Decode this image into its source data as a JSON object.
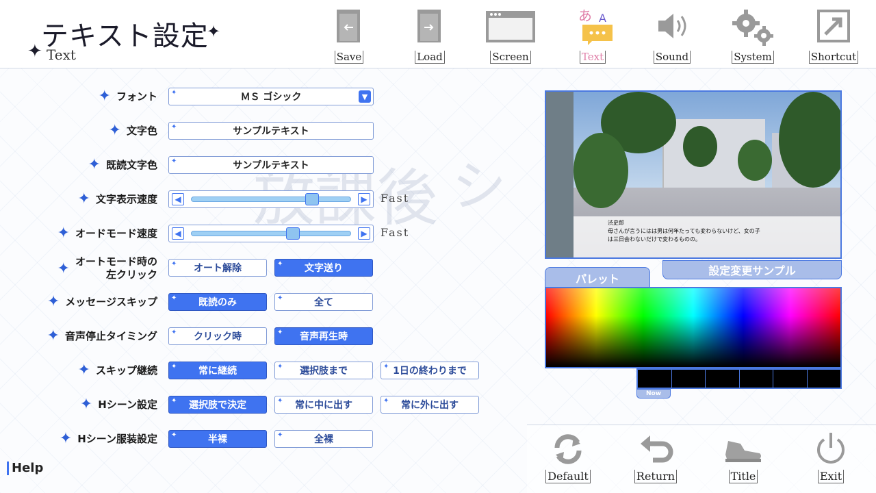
{
  "logo": {
    "title_jp": "テキスト設定",
    "title_en": "Text"
  },
  "nav": [
    {
      "id": "save",
      "label": "Save"
    },
    {
      "id": "load",
      "label": "Load"
    },
    {
      "id": "screen",
      "label": "Screen"
    },
    {
      "id": "text",
      "label": "Text"
    },
    {
      "id": "sound",
      "label": "Sound"
    },
    {
      "id": "system",
      "label": "System"
    },
    {
      "id": "shortcut",
      "label": "Shortcut"
    }
  ],
  "text_icon_glyphs": {
    "a": "あ",
    "b": "A"
  },
  "settings": {
    "font": {
      "label": "フォント",
      "value": "ＭＳ ゴシック"
    },
    "text_color": {
      "label": "文字色",
      "value": "サンプルテキスト"
    },
    "read_text_color": {
      "label": "既読文字色",
      "value": "サンプルテキスト"
    },
    "text_speed": {
      "label": "文字表示速度",
      "end_label": "Fast",
      "level": 0.78
    },
    "auto_speed": {
      "label": "オードモード速度",
      "end_label": "Fast",
      "level": 0.65
    },
    "auto_left_click": {
      "label_line1": "オートモード時の",
      "label_line2": "左クリック",
      "options": [
        "オート解除",
        "文字送り"
      ],
      "selected": 1
    },
    "message_skip": {
      "label": "メッセージスキップ",
      "options": [
        "既読のみ",
        "全て"
      ],
      "selected": 0
    },
    "voice_stop": {
      "label": "音声停止タイミング",
      "options": [
        "クリック時",
        "音声再生時"
      ],
      "selected": 1
    },
    "skip_continue": {
      "label": "スキップ継続",
      "options": [
        "常に継続",
        "選択肢まで",
        "1日の終わりまで"
      ],
      "selected": 0
    },
    "h_scene": {
      "label": "Hシーン設定",
      "options": [
        "選択肢で決定",
        "常に中に出す",
        "常に外に出す"
      ],
      "selected": 0
    },
    "h_costume": {
      "label": "Hシーン服装設定",
      "options": [
        "半裸",
        "全裸"
      ],
      "selected": 0
    }
  },
  "preview": {
    "speaker": "渋史郎",
    "line1": "母さんが言うにはは男は何年たっても変わらないけど、女の子",
    "line2": "は三日会わないだけで変わるものの。",
    "tab_label": "設定変更サンプル"
  },
  "palette": {
    "tab_label": "パレット",
    "now_label": "Now",
    "swatch_colors": [
      "#000000",
      "#000000",
      "#000000",
      "#000000",
      "#000000",
      "#000000"
    ]
  },
  "bottom_nav": [
    {
      "id": "default",
      "label": "Default"
    },
    {
      "id": "return",
      "label": "Return"
    },
    {
      "id": "title",
      "label": "Title"
    },
    {
      "id": "exit",
      "label": "Exit"
    }
  ],
  "help_label": "Help",
  "colors": {
    "accent": "#3f73f0",
    "active_nav": "#e07fa8"
  }
}
